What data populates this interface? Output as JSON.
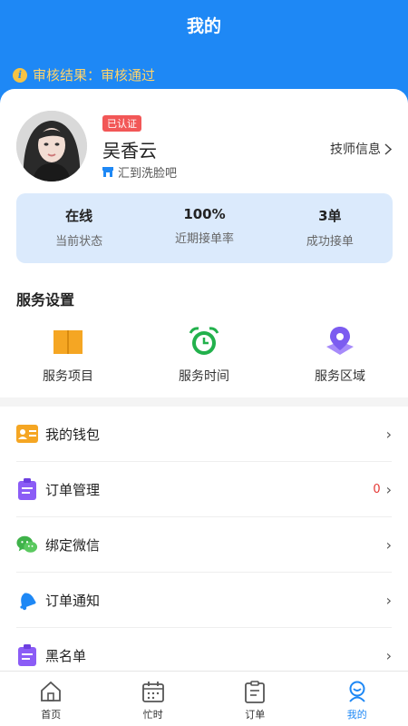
{
  "header": {
    "title": "我的",
    "audit": "审核结果：审核通过"
  },
  "profile": {
    "badge": "已认证",
    "name": "吴香云",
    "store": "汇到洗脸吧",
    "tech_info": "技师信息"
  },
  "stats": [
    {
      "value": "在线",
      "label": "当前状态"
    },
    {
      "value": "100%",
      "label": "近期接单率"
    },
    {
      "value": "3单",
      "label": "成功接单"
    }
  ],
  "services": {
    "title": "服务设置",
    "items": [
      {
        "label": "服务项目",
        "icon": "book-icon"
      },
      {
        "label": "服务时间",
        "icon": "alarm-clock-icon"
      },
      {
        "label": "服务区域",
        "icon": "location-pin-icon"
      }
    ]
  },
  "menu": [
    {
      "label": "我的钱包",
      "icon": "wallet-icon"
    },
    {
      "label": "订单管理",
      "icon": "clipboard-icon",
      "count": "0"
    },
    {
      "label": "绑定微信",
      "icon": "wechat-icon"
    },
    {
      "label": "订单通知",
      "icon": "bell-icon"
    },
    {
      "label": "黑名单",
      "icon": "clipboard-icon"
    }
  ],
  "tabbar": [
    {
      "label": "首页",
      "icon": "home-icon"
    },
    {
      "label": "忙时",
      "icon": "calendar-icon"
    },
    {
      "label": "订单",
      "icon": "clipboard-icon"
    },
    {
      "label": "我的",
      "icon": "profile-icon",
      "active": true
    }
  ],
  "colors": {
    "primary": "#1e88f5",
    "badge": "#f25757",
    "count": "#e53935",
    "stats_bg": "#dbeafc"
  }
}
